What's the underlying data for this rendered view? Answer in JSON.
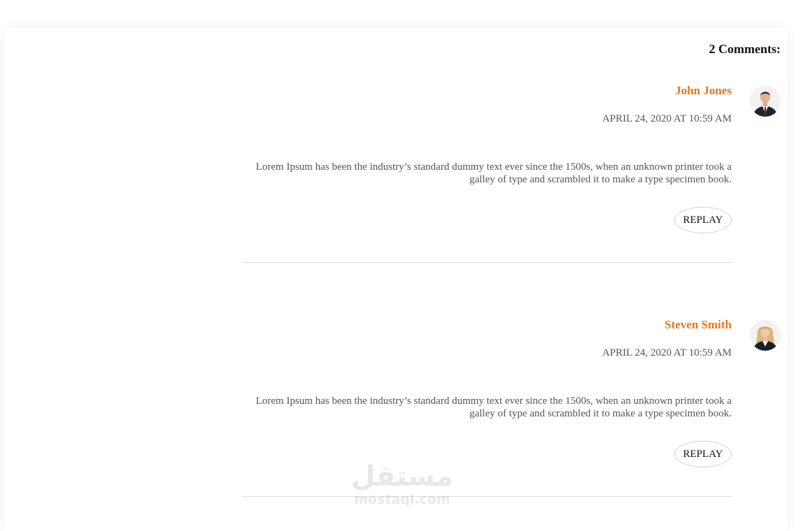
{
  "comments_section": {
    "title": "2 Comments:",
    "accent_color": "#e8751a",
    "comments": [
      {
        "author": "John Jones",
        "avatar_icon": "man-avatar-icon",
        "date": "APRIL 24, 2020 AT 10:59 AM",
        "text": "Lorem Ipsum has been the industry’s standard dummy text ever since the 1500s, when an unknown printer took a galley of type and scrambled it to make a type specimen book.",
        "reply_label": "REPLAY"
      },
      {
        "author": "Steven Smith",
        "avatar_icon": "woman-avatar-icon",
        "date": "APRIL 24, 2020 AT 10:59 AM",
        "text": "Lorem Ipsum has been the industry’s standard dummy text ever since the 1500s, when an unknown printer took a galley of type and scrambled it to make a type specimen book.",
        "reply_label": "REPLAY"
      }
    ]
  },
  "watermark": {
    "arabic": "مستقل",
    "latin": "mostaql.com"
  }
}
